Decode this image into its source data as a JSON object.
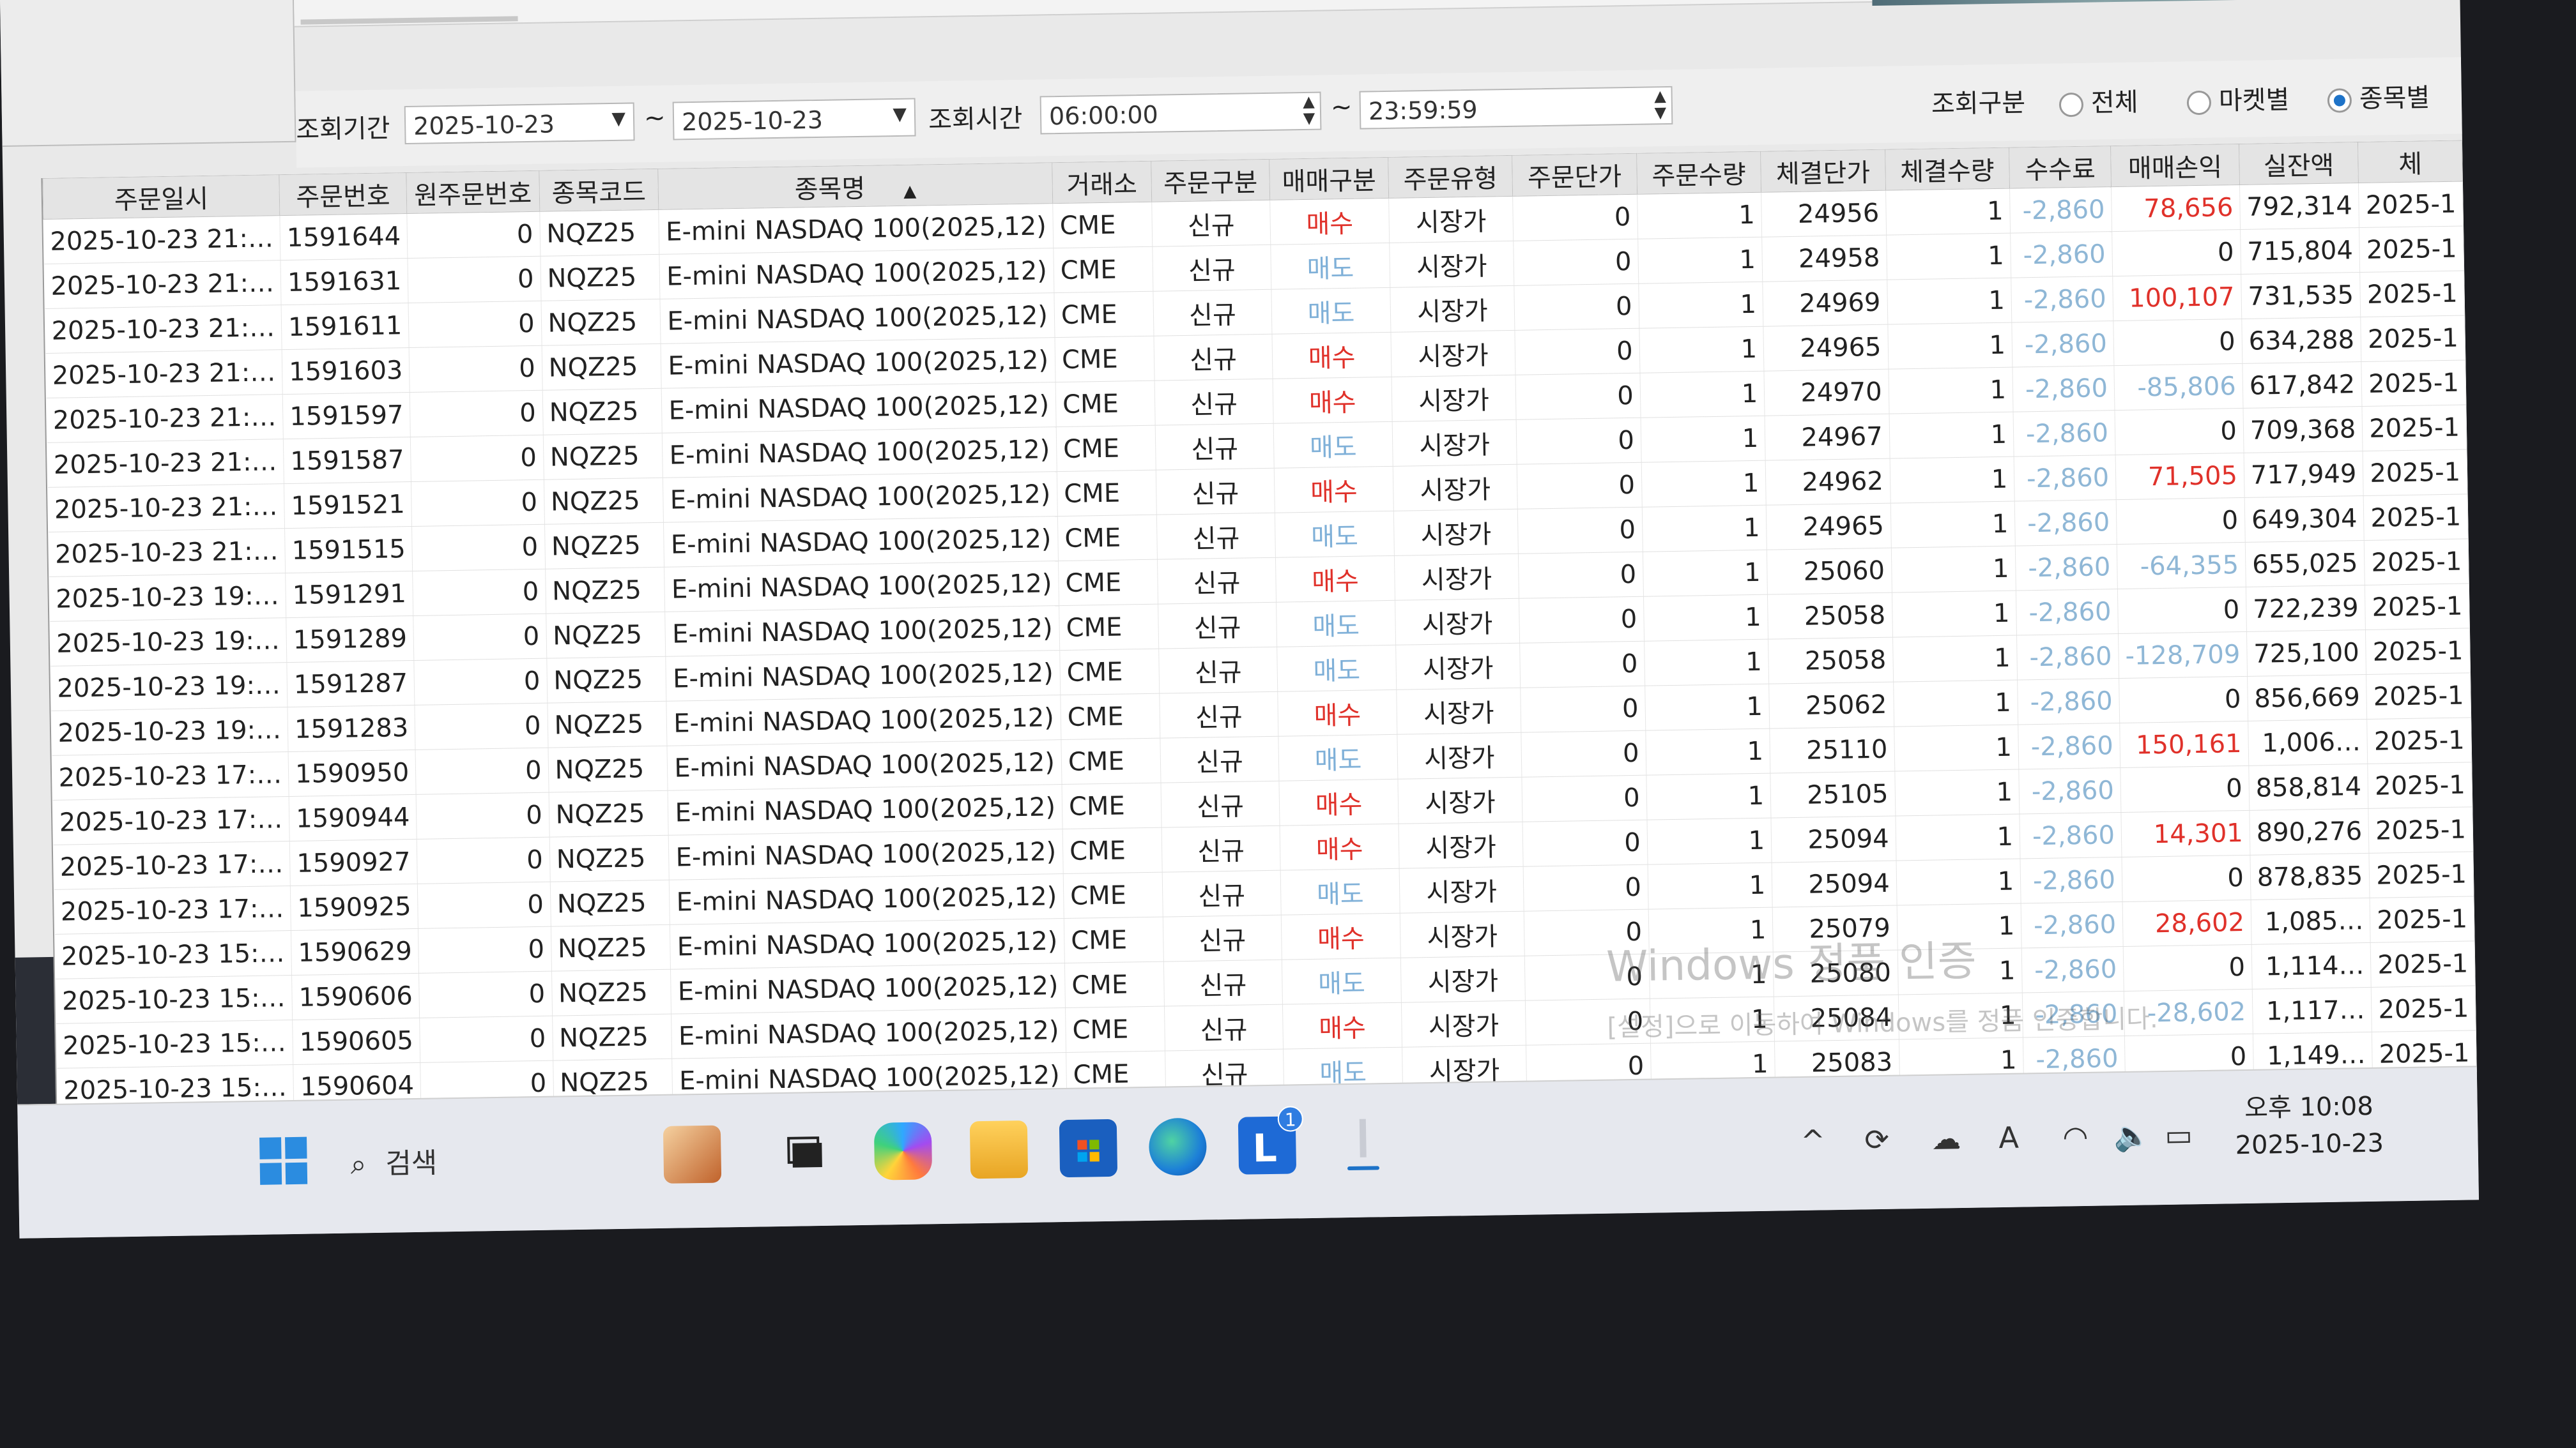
{
  "filter": {
    "period_label": "조회기간",
    "date_from": "2025-10-23",
    "date_to": "2025-10-23",
    "tilde": "~",
    "time_label": "조회시간",
    "time_from": "06:00:00",
    "time_to": "23:59:59",
    "type_label": "조회구분",
    "options": [
      {
        "label": "전체",
        "selected": false
      },
      {
        "label": "마켓별",
        "selected": false
      },
      {
        "label": "종목별",
        "selected": true
      }
    ]
  },
  "columns": [
    "주문일시",
    "주문번호",
    "원주문번호",
    "종목코드",
    "종목명",
    "거래소",
    "주문구분",
    "매매구분",
    "주문유형",
    "주문단가",
    "주문수량",
    "체결단가",
    "체결수량",
    "수수료",
    "매매손익",
    "실잔액",
    "체"
  ],
  "sort_indicator": "▲",
  "rows": [
    [
      "2025-10-23 21:…",
      "1591644",
      "0",
      "NQZ25",
      "E-mini NASDAQ 100(2025,12)",
      "CME",
      "신규",
      "매수",
      "시장가",
      "0",
      "1",
      "24956",
      "1",
      "-2,860",
      "78,656",
      "792,314",
      "2025-1"
    ],
    [
      "2025-10-23 21:…",
      "1591631",
      "0",
      "NQZ25",
      "E-mini NASDAQ 100(2025,12)",
      "CME",
      "신규",
      "매도",
      "시장가",
      "0",
      "1",
      "24958",
      "1",
      "-2,860",
      "0",
      "715,804",
      "2025-1"
    ],
    [
      "2025-10-23 21:…",
      "1591611",
      "0",
      "NQZ25",
      "E-mini NASDAQ 100(2025,12)",
      "CME",
      "신규",
      "매도",
      "시장가",
      "0",
      "1",
      "24969",
      "1",
      "-2,860",
      "100,107",
      "731,535",
      "2025-1"
    ],
    [
      "2025-10-23 21:…",
      "1591603",
      "0",
      "NQZ25",
      "E-mini NASDAQ 100(2025,12)",
      "CME",
      "신규",
      "매수",
      "시장가",
      "0",
      "1",
      "24965",
      "1",
      "-2,860",
      "0",
      "634,288",
      "2025-1"
    ],
    [
      "2025-10-23 21:…",
      "1591597",
      "0",
      "NQZ25",
      "E-mini NASDAQ 100(2025,12)",
      "CME",
      "신규",
      "매수",
      "시장가",
      "0",
      "1",
      "24970",
      "1",
      "-2,860",
      "-85,806",
      "617,842",
      "2025-1"
    ],
    [
      "2025-10-23 21:…",
      "1591587",
      "0",
      "NQZ25",
      "E-mini NASDAQ 100(2025,12)",
      "CME",
      "신규",
      "매도",
      "시장가",
      "0",
      "1",
      "24967",
      "1",
      "-2,860",
      "0",
      "709,368",
      "2025-1"
    ],
    [
      "2025-10-23 21:…",
      "1591521",
      "0",
      "NQZ25",
      "E-mini NASDAQ 100(2025,12)",
      "CME",
      "신규",
      "매수",
      "시장가",
      "0",
      "1",
      "24962",
      "1",
      "-2,860",
      "71,505",
      "717,949",
      "2025-1"
    ],
    [
      "2025-10-23 21:…",
      "1591515",
      "0",
      "NQZ25",
      "E-mini NASDAQ 100(2025,12)",
      "CME",
      "신규",
      "매도",
      "시장가",
      "0",
      "1",
      "24965",
      "1",
      "-2,860",
      "0",
      "649,304",
      "2025-1"
    ],
    [
      "2025-10-23 19:…",
      "1591291",
      "0",
      "NQZ25",
      "E-mini NASDAQ 100(2025,12)",
      "CME",
      "신규",
      "매수",
      "시장가",
      "0",
      "1",
      "25060",
      "1",
      "-2,860",
      "-64,355",
      "655,025",
      "2025-1"
    ],
    [
      "2025-10-23 19:…",
      "1591289",
      "0",
      "NQZ25",
      "E-mini NASDAQ 100(2025,12)",
      "CME",
      "신규",
      "매도",
      "시장가",
      "0",
      "1",
      "25058",
      "1",
      "-2,860",
      "0",
      "722,239",
      "2025-1"
    ],
    [
      "2025-10-23 19:…",
      "1591287",
      "0",
      "NQZ25",
      "E-mini NASDAQ 100(2025,12)",
      "CME",
      "신규",
      "매도",
      "시장가",
      "0",
      "1",
      "25058",
      "1",
      "-2,860",
      "-128,709",
      "725,100",
      "2025-1"
    ],
    [
      "2025-10-23 19:…",
      "1591283",
      "0",
      "NQZ25",
      "E-mini NASDAQ 100(2025,12)",
      "CME",
      "신규",
      "매수",
      "시장가",
      "0",
      "1",
      "25062",
      "1",
      "-2,860",
      "0",
      "856,669",
      "2025-1"
    ],
    [
      "2025-10-23 17:…",
      "1590950",
      "0",
      "NQZ25",
      "E-mini NASDAQ 100(2025,12)",
      "CME",
      "신규",
      "매도",
      "시장가",
      "0",
      "1",
      "25110",
      "1",
      "-2,860",
      "150,161",
      "1,006…",
      "2025-1"
    ],
    [
      "2025-10-23 17:…",
      "1590944",
      "0",
      "NQZ25",
      "E-mini NASDAQ 100(2025,12)",
      "CME",
      "신규",
      "매수",
      "시장가",
      "0",
      "1",
      "25105",
      "1",
      "-2,860",
      "0",
      "858,814",
      "2025-1"
    ],
    [
      "2025-10-23 17:…",
      "1590927",
      "0",
      "NQZ25",
      "E-mini NASDAQ 100(2025,12)",
      "CME",
      "신규",
      "매수",
      "시장가",
      "0",
      "1",
      "25094",
      "1",
      "-2,860",
      "14,301",
      "890,276",
      "2025-1"
    ],
    [
      "2025-10-23 17:…",
      "1590925",
      "0",
      "NQZ25",
      "E-mini NASDAQ 100(2025,12)",
      "CME",
      "신규",
      "매도",
      "시장가",
      "0",
      "1",
      "25094",
      "1",
      "-2,860",
      "0",
      "878,835",
      "2025-1"
    ],
    [
      "2025-10-23 15:…",
      "1590629",
      "0",
      "NQZ25",
      "E-mini NASDAQ 100(2025,12)",
      "CME",
      "신규",
      "매수",
      "시장가",
      "0",
      "1",
      "25079",
      "1",
      "-2,860",
      "28,602",
      "1,085…",
      "2025-1"
    ],
    [
      "2025-10-23 15:…",
      "1590606",
      "0",
      "NQZ25",
      "E-mini NASDAQ 100(2025,12)",
      "CME",
      "신규",
      "매도",
      "시장가",
      "0",
      "1",
      "25080",
      "1",
      "-2,860",
      "0",
      "1,114…",
      "2025-1"
    ],
    [
      "2025-10-23 15:…",
      "1590605",
      "0",
      "NQZ25",
      "E-mini NASDAQ 100(2025,12)",
      "CME",
      "신규",
      "매수",
      "시장가",
      "0",
      "1",
      "25084",
      "1",
      "-2,860",
      "-28,602",
      "1,117…",
      "2025-1"
    ],
    [
      "2025-10-23 15:…",
      "1590604",
      "0",
      "NQZ25",
      "E-mini NASDAQ 100(2025,12)",
      "CME",
      "신규",
      "매도",
      "시장가",
      "0",
      "1",
      "25083",
      "1",
      "-2,860",
      "0",
      "1,149…",
      "2025-1"
    ]
  ],
  "watermark": {
    "line1": "Windows 정품 인증",
    "line2": "[설정]으로 이동하여 Windows를 정품 인증합니다."
  },
  "taskbar": {
    "search_label": "검색",
    "apps": [
      "windows-start-icon",
      "search-icon",
      "widgets-icon",
      "task-view-icon",
      "copilot-icon",
      "file-explorer-icon",
      "microsoft-store-icon",
      "edge-icon",
      "app-l-icon",
      "active-app-icon"
    ],
    "badge": "1",
    "clock_time": "오후 10:08",
    "clock_date": "2025-10-23"
  },
  "colors": {
    "buy": "#e0312a",
    "sell": "#7fb0d8",
    "fee": "#8fb7d6",
    "selected_radio": "#1e73c8"
  }
}
